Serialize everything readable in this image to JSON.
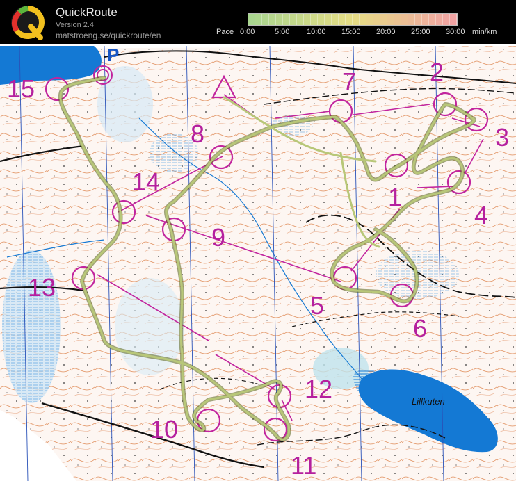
{
  "header": {
    "title": "QuickRoute",
    "version": "Version 2.4",
    "url": "matstroeng.se/quickroute/en",
    "pace_label": "Pace",
    "pace_ticks": [
      "0:00",
      "5:00",
      "10:00",
      "15:00",
      "20:00",
      "25:00",
      "30:00"
    ],
    "pace_unit": "min/km",
    "pace_colors": [
      "#a9d58f",
      "#e6dd85",
      "#f1a3a3"
    ]
  },
  "map": {
    "parking_label": "P",
    "lake_label": "Lillkuten",
    "controls": [
      "1",
      "2",
      "3",
      "4",
      "5",
      "6",
      "7",
      "8",
      "9",
      "10",
      "11",
      "12",
      "13",
      "14",
      "15"
    ]
  },
  "colors": {
    "course": "#c2259e",
    "route": "#9faa55",
    "water": "#1479d4",
    "contour": "#e08a58"
  }
}
